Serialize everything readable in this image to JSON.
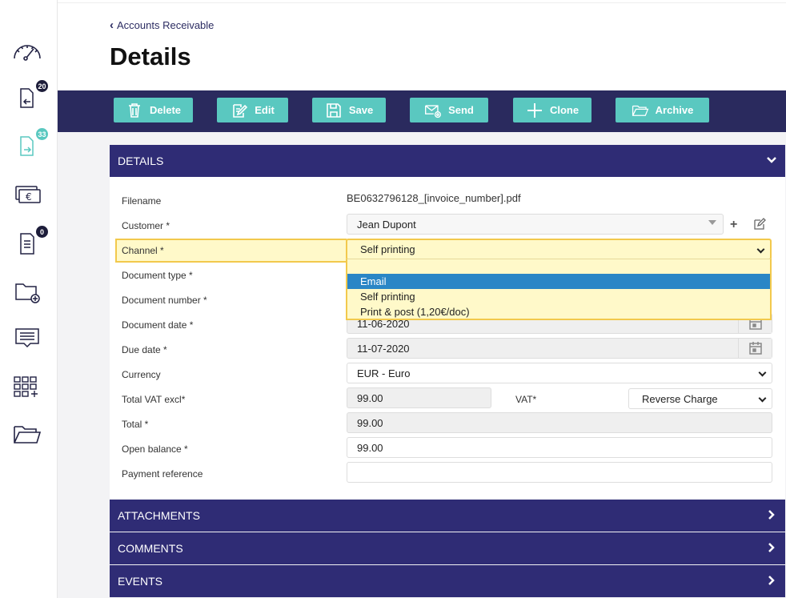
{
  "sidebar": {
    "badges": {
      "inbound": "20",
      "outbound": "33",
      "orders": "0"
    }
  },
  "breadcrumb": {
    "label": "Accounts Receivable"
  },
  "page": {
    "title": "Details"
  },
  "toolbar": {
    "delete": "Delete",
    "edit": "Edit",
    "save": "Save",
    "send": "Send",
    "clone": "Clone",
    "archive": "Archive"
  },
  "sections": {
    "details": "DETAILS",
    "attachments": "ATTACHMENTS",
    "comments": "COMMENTS",
    "events": "EVENTS"
  },
  "form": {
    "filename": {
      "label": "Filename",
      "value": "BE0632796128_[invoice_number].pdf"
    },
    "customer": {
      "label": "Customer *",
      "value": "Jean Dupont"
    },
    "channel": {
      "label": "Channel *",
      "value": "Self printing",
      "options": [
        "Email",
        "Self printing",
        "Print & post (1,20€/doc)"
      ]
    },
    "document_type": {
      "label": "Document type *"
    },
    "document_number": {
      "label": "Document number *"
    },
    "document_date": {
      "label": "Document date *",
      "value": "11-06-2020"
    },
    "due_date": {
      "label": "Due date *",
      "value": "11-07-2020"
    },
    "currency": {
      "label": "Currency",
      "value": "EUR - Euro"
    },
    "total_vat_excl": {
      "label": "Total VAT excl*",
      "value": "99.00"
    },
    "vat": {
      "label": "VAT*",
      "value": "Reverse Charge"
    },
    "total": {
      "label": "Total *",
      "value": "99.00"
    },
    "open_balance": {
      "label": "Open balance *",
      "value": "99.00"
    },
    "payment_reference": {
      "label": "Payment reference",
      "value": ""
    }
  },
  "colors": {
    "navy": "#2a2a5e",
    "section": "#2f2c75",
    "teal": "#5ac8c0",
    "highlight": "#fff9c9",
    "highlight_border": "#f2c94c",
    "selected": "#2a86c6"
  }
}
